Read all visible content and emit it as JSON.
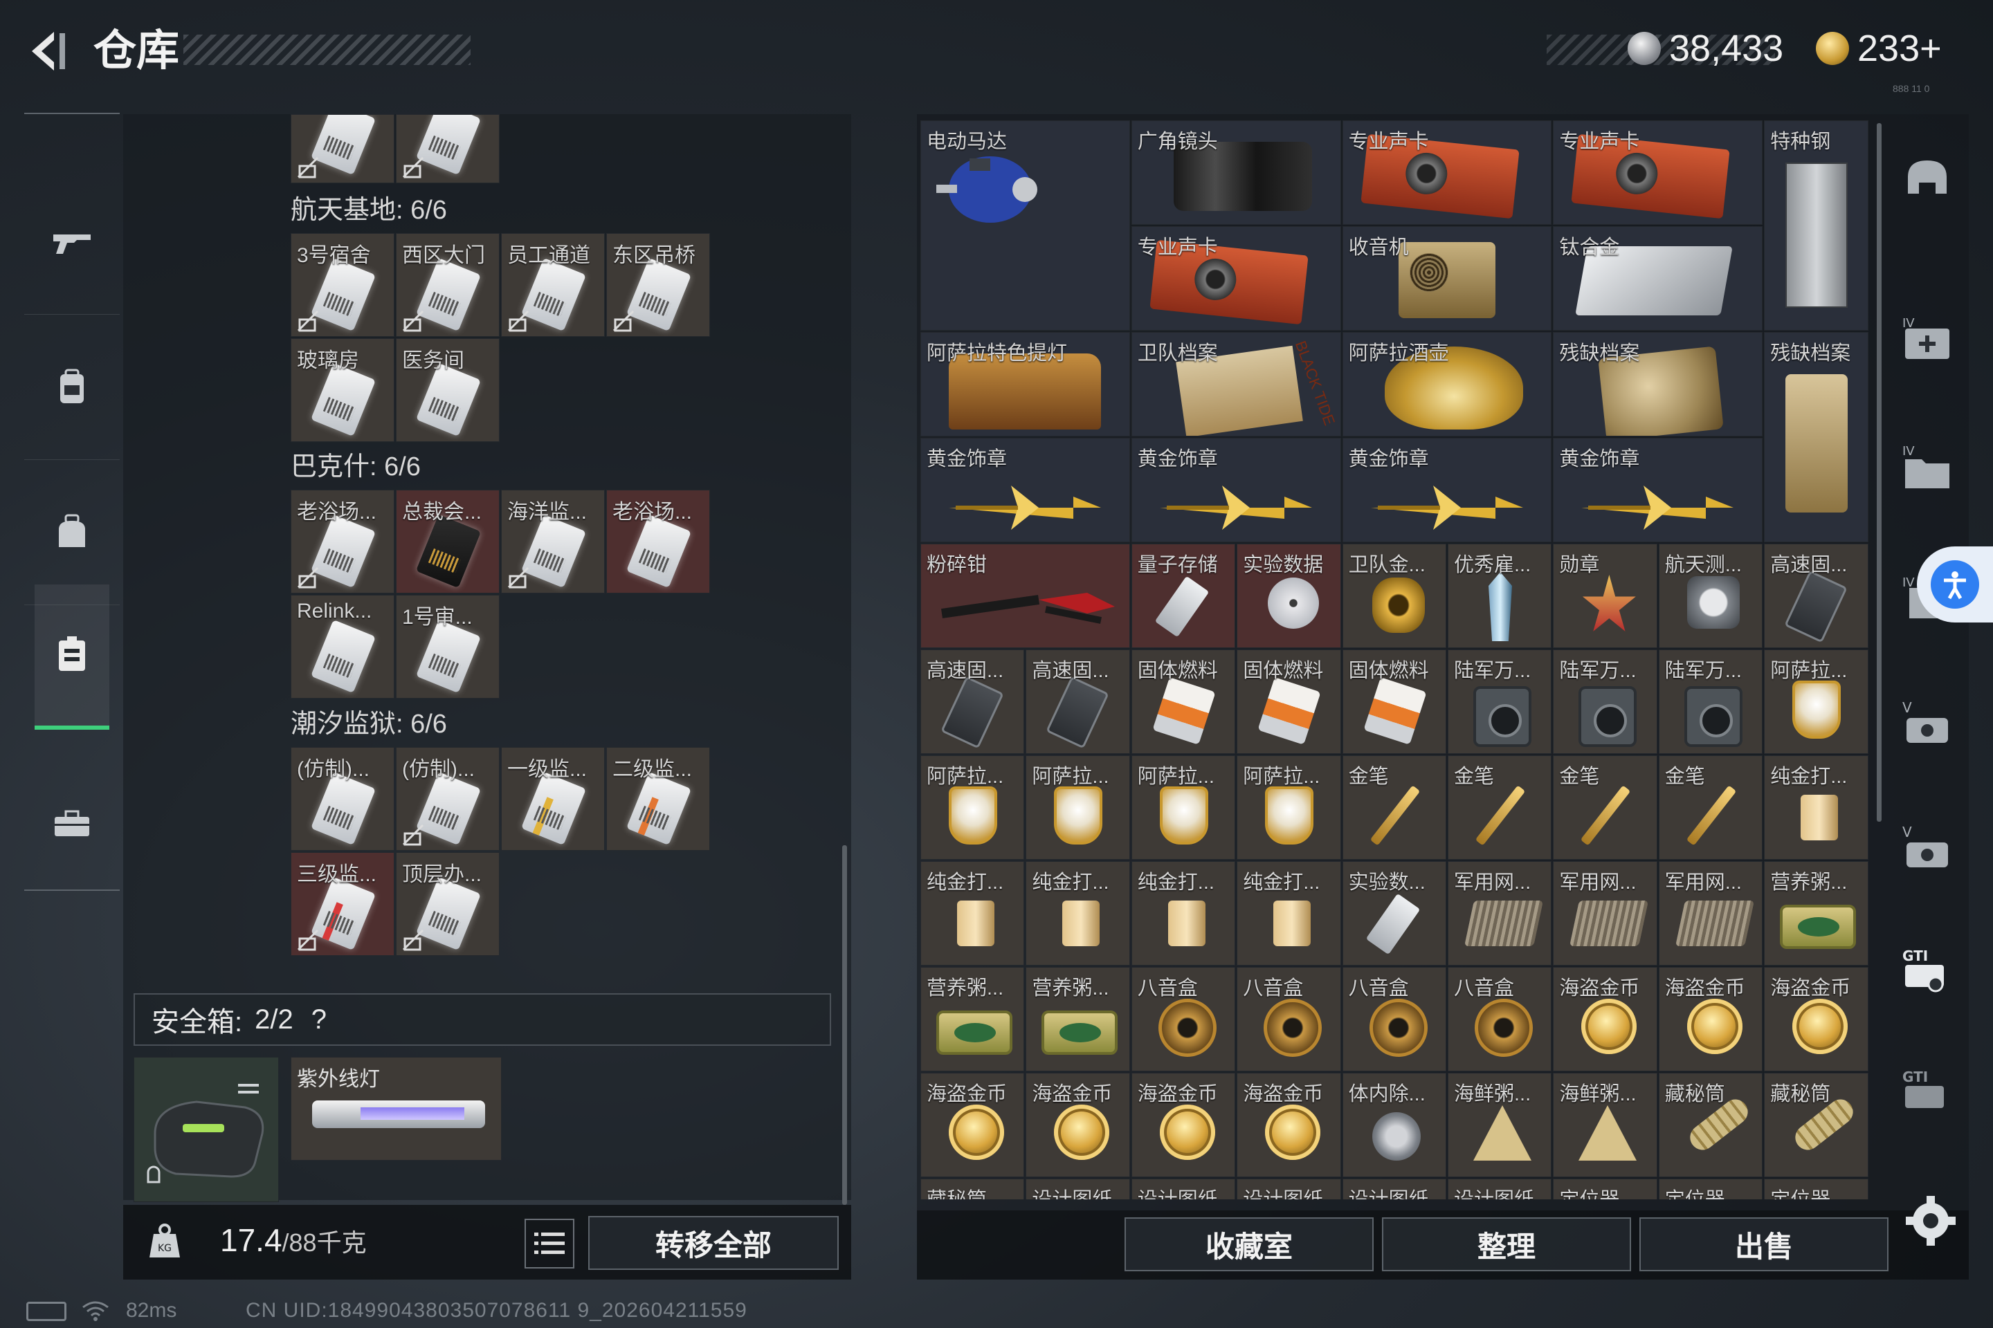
{
  "header": {
    "title": "仓库",
    "currency_silver": "38,433",
    "currency_gold": "233+"
  },
  "left_nav": [
    "gun-icon",
    "backpack-icon",
    "bag-icon",
    "safebox-icon",
    "toolbox-icon"
  ],
  "left_panel": {
    "section1": {
      "label": "航天基地: 6/6",
      "items": [
        "3号宿舍",
        "西区大门",
        "员工通道",
        "东区吊桥",
        "玻璃房",
        "医务间"
      ]
    },
    "section2": {
      "label": "巴克什: 6/6",
      "items": [
        "老浴场...",
        "总裁会...",
        "海洋监...",
        "老浴场...",
        "Relink...",
        "1号审..."
      ]
    },
    "section3": {
      "label": "潮汐监狱: 6/6",
      "items": [
        "(仿制)...",
        "(仿制)...",
        "一级监...",
        "二级监...",
        "三级监...",
        "顶层办..."
      ]
    },
    "safebox": {
      "label": "安全箱:",
      "count": "2/2",
      "help": "?",
      "item": "紫外线灯"
    },
    "weight": {
      "current": "17.4",
      "capacity": "/88千克"
    },
    "transfer_all": "转移全部"
  },
  "grid": {
    "big_items": [
      {
        "name": "电动马达"
      },
      {
        "name": "广角镜头"
      },
      {
        "name": "专业声卡"
      },
      {
        "name": "专业声卡"
      },
      {
        "name": "特种钢"
      },
      {
        "name": "专业声卡"
      },
      {
        "name": "收音机"
      },
      {
        "name": "钛合金"
      },
      {
        "name": "阿萨拉特色提灯"
      },
      {
        "name": "卫队档案"
      },
      {
        "name": "阿萨拉酒壶"
      },
      {
        "name": "残缺档案"
      },
      {
        "name": "残缺档案"
      },
      {
        "name": "黄金饰章"
      },
      {
        "name": "黄金饰章"
      },
      {
        "name": "黄金饰章"
      },
      {
        "name": "黄金饰章"
      },
      {
        "name": "粉碎钳"
      }
    ],
    "row5": [
      "量子存储",
      "实验数据",
      "卫队金...",
      "优秀雇...",
      "勋章",
      "航天测...",
      "高速固..."
    ],
    "row6": [
      "高速固...",
      "高速固...",
      "固体燃料",
      "固体燃料",
      "固体燃料",
      "陆军万...",
      "陆军万...",
      "陆军万...",
      "阿萨拉..."
    ],
    "row7": [
      "阿萨拉...",
      "阿萨拉...",
      "阿萨拉...",
      "阿萨拉...",
      "金笔",
      "金笔",
      "金笔",
      "金笔",
      "纯金打..."
    ],
    "row8": [
      "纯金打...",
      "纯金打...",
      "纯金打...",
      "纯金打...",
      "实验数...",
      "军用网...",
      "军用网...",
      "军用网...",
      "营养粥..."
    ],
    "row9": [
      "营养粥...",
      "营养粥...",
      "八音盒",
      "八音盒",
      "八音盒",
      "八音盒",
      "海盗金币",
      "海盗金币",
      "海盗金币"
    ],
    "row10": [
      "海盗金币",
      "海盗金币",
      "海盗金币",
      "海盗金币",
      "体内除...",
      "海鲜粥...",
      "海鲜粥...",
      "藏秘筒",
      "藏秘筒"
    ],
    "row11": [
      "藏秘筒",
      "设计图纸",
      "设计图纸",
      "设计图纸",
      "设计图纸",
      "设计图纸",
      "定位器",
      "定位器",
      "定位器"
    ],
    "special_tag": "BLACK TIDE"
  },
  "buttons": {
    "collection": "收藏室",
    "sort": "整理",
    "sell": "出售"
  },
  "right_nav": {
    "gti1": "GTI",
    "gti2": "GTI",
    "iv1": "IV",
    "iv2": "IV",
    "v1": "V",
    "v2": "V",
    "iv3": "IV"
  },
  "status": {
    "ping": "82ms",
    "uid": "CN UID:18499043803507078611 9_202604211559",
    "version": "888 11 0"
  },
  "colors": {
    "accent_green": "#3ed07c",
    "item_red": "#4e2f2f",
    "item_brown": "#3e3a36",
    "item_blue": "#2a2f3a"
  }
}
